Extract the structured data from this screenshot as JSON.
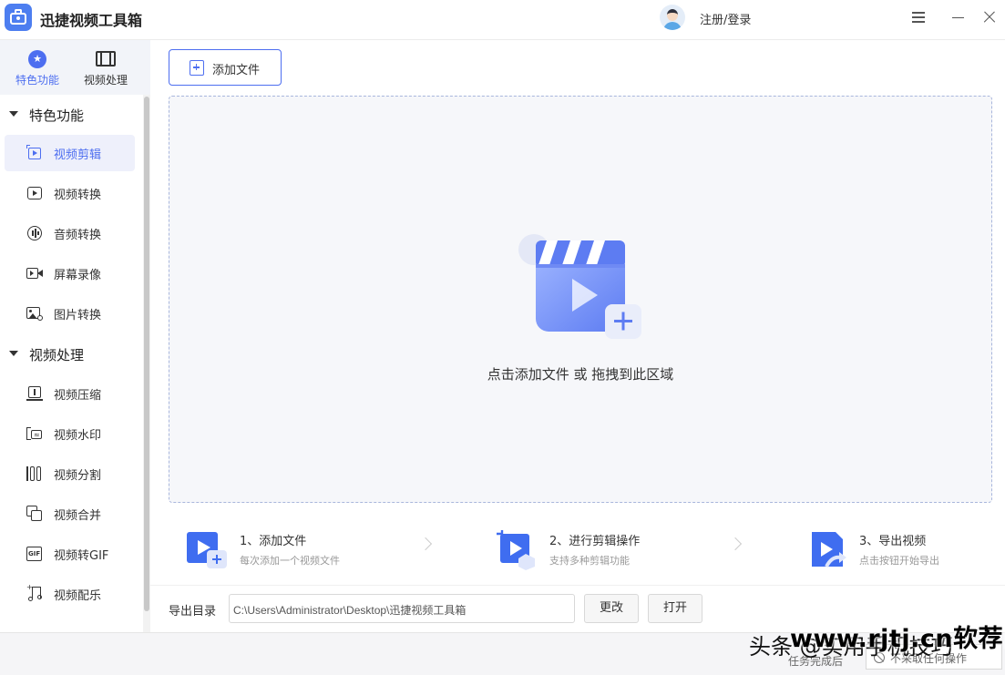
{
  "app": {
    "title": "迅捷视频工具箱",
    "login": "注册/登录"
  },
  "sidebar": {
    "top_tabs": [
      {
        "label": "特色功能",
        "icon": "star-icon",
        "active": true
      },
      {
        "label": "视频处理",
        "icon": "film-icon",
        "active": false
      }
    ],
    "groups": [
      {
        "label": "特色功能",
        "items": [
          {
            "label": "视频剪辑",
            "icon": "video-edit-icon",
            "active": true
          },
          {
            "label": "视频转换",
            "icon": "video-convert-icon"
          },
          {
            "label": "音频转换",
            "icon": "audio-convert-icon"
          },
          {
            "label": "屏幕录像",
            "icon": "screen-record-icon"
          },
          {
            "label": "图片转换",
            "icon": "image-convert-icon"
          }
        ]
      },
      {
        "label": "视频处理",
        "items": [
          {
            "label": "视频压缩",
            "icon": "video-compress-icon"
          },
          {
            "label": "视频水印",
            "icon": "video-watermark-icon"
          },
          {
            "label": "视频分割",
            "icon": "video-split-icon"
          },
          {
            "label": "视频合并",
            "icon": "video-merge-icon"
          },
          {
            "label": "视频转GIF",
            "icon": "gif-icon"
          },
          {
            "label": "视频配乐",
            "icon": "music-note-icon"
          }
        ]
      }
    ]
  },
  "main": {
    "add_file": "添加文件",
    "drop_hint": "点击添加文件 或 拖拽到此区域",
    "steps": [
      {
        "title": "1、添加文件",
        "sub": "每次添加一个视频文件"
      },
      {
        "title": "2、进行剪辑操作",
        "sub": "支持多种剪辑功能"
      },
      {
        "title": "3、导出视频",
        "sub": "点击按钮开始导出"
      }
    ],
    "export": {
      "label": "导出目录",
      "path": "C:\\Users\\Administrator\\Desktop\\迅捷视频工具箱",
      "change": "更改",
      "open": "打开"
    }
  },
  "status": {
    "label": "任务完成后",
    "option": "不采取任何操作"
  },
  "watermark": {
    "line1": "头条 @实用手机技巧",
    "line2": "www.rjtj.cn软荐网"
  },
  "colors": {
    "accent": "#4d6ef0",
    "dropzone_bg": "#f6f7fa",
    "dropzone_border": "#a8b6dc"
  }
}
